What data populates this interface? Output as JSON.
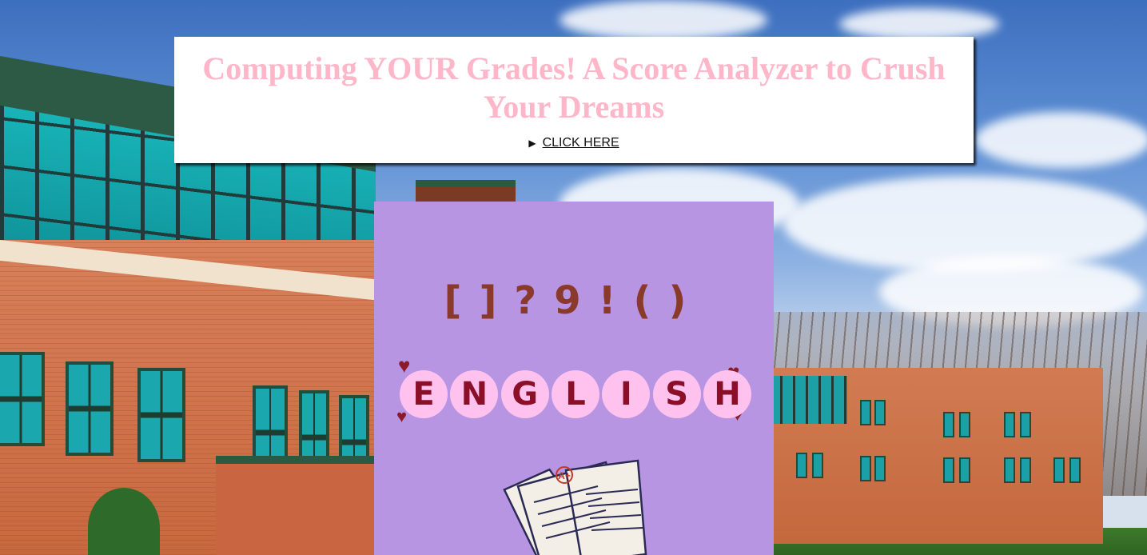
{
  "header": {
    "title": "Computing YOUR Grades! A Score Analyzer to Crush Your Dreams",
    "disclosure_marker": "▶",
    "disclosure_label": "CLICK HERE"
  },
  "english_panel": {
    "punctuation": "[]?9!()",
    "word_letters": [
      "E",
      "N",
      "G",
      "L",
      "I",
      "S",
      "H"
    ],
    "grade_mark": "A+",
    "colors": {
      "panel_bg": "#b895e3",
      "bubble": "#ffc2ef",
      "letters": "#8b0f28",
      "hearts": "#8b1a2a"
    }
  },
  "theme": {
    "title_color": "#ffb6c8",
    "card_bg": "#ffffff"
  }
}
